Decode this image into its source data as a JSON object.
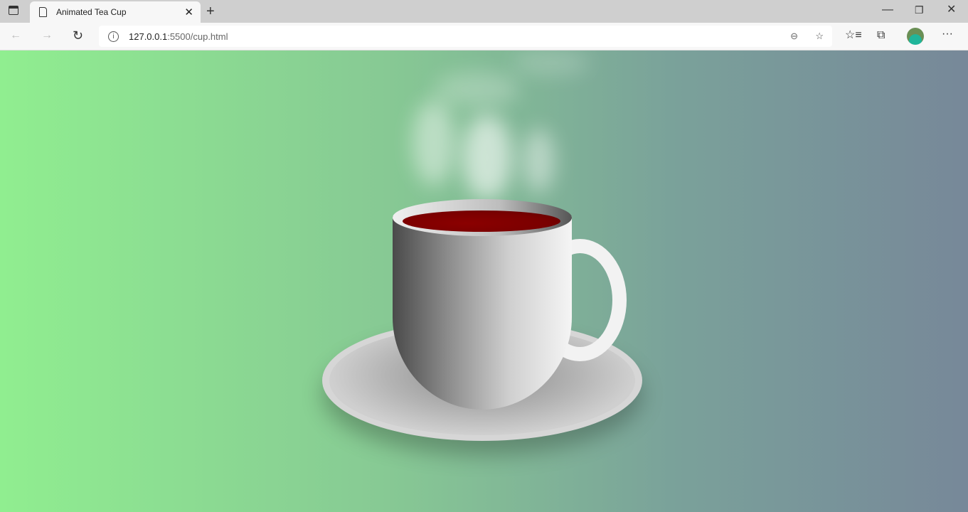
{
  "browser": {
    "tab_title": "Animated Tea Cup",
    "url_host": "127.0.0.1",
    "url_path": ":5500/cup.html",
    "icons": [
      "tab-actions-icon",
      "page-icon",
      "close-icon",
      "new-tab-icon",
      "back-icon",
      "forward-icon",
      "refresh-icon",
      "info-icon",
      "zoom-out-icon",
      "add-favorite-icon",
      "favorites-icon",
      "collections-icon",
      "profile-avatar",
      "more-icon",
      "minimize-icon",
      "restore-icon",
      "window-close-icon"
    ]
  },
  "colors": {
    "tea": "#8b0000",
    "bg_start": "#90ee90",
    "bg_end": "#778899"
  }
}
